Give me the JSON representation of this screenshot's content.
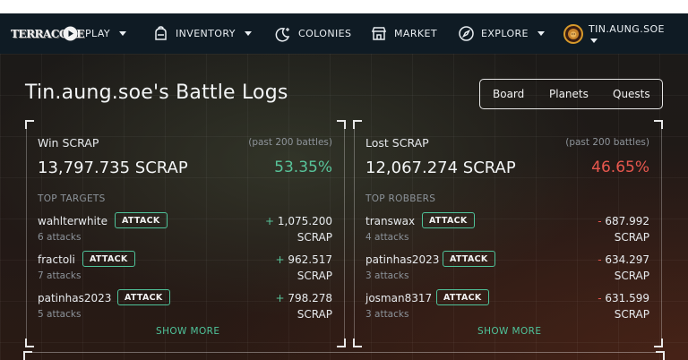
{
  "nav": {
    "logo": "TERRACORE",
    "items": [
      {
        "label": "PLAY",
        "icon": "play-circle-icon",
        "dropdown": true
      },
      {
        "label": "INVENTORY",
        "icon": "backpack-icon",
        "dropdown": true
      },
      {
        "label": "COLONIES",
        "icon": "moon-stars-icon",
        "dropdown": false
      },
      {
        "label": "MARKET",
        "icon": "storefront-icon",
        "dropdown": false
      },
      {
        "label": "EXPLORE",
        "icon": "compass-icon",
        "dropdown": true
      }
    ],
    "user": {
      "name": "TIN.AUNG.SOE",
      "icon": "lion-avatar-icon"
    }
  },
  "page": {
    "title": "Tin.aung.soe's Battle Logs",
    "tabs": [
      "Board",
      "Planets",
      "Quests"
    ]
  },
  "win_panel": {
    "title": "Win SCRAP",
    "note": "(past 200 battles)",
    "total": "13,797.735 SCRAP",
    "percent": "53.35%",
    "section": "TOP TARGETS",
    "rows": [
      {
        "name": "wahlterwhite",
        "sub": "6 attacks",
        "button": "ATTACK",
        "sign": "+",
        "amount": "1,075.200",
        "unit": "SCRAP"
      },
      {
        "name": "fractoli",
        "sub": "7 attacks",
        "button": "ATTACK",
        "sign": "+",
        "amount": "962.517",
        "unit": "SCRAP"
      },
      {
        "name": "patinhas2023",
        "sub": "5 attacks",
        "button": "ATTACK",
        "sign": "+",
        "amount": "798.278",
        "unit": "SCRAP"
      }
    ],
    "show_more": "SHOW MORE"
  },
  "lost_panel": {
    "title": "Lost SCRAP",
    "note": "(past 200 battles)",
    "total": "12,067.274 SCRAP",
    "percent": "46.65%",
    "section": "TOP ROBBERS",
    "rows": [
      {
        "name": "transwax",
        "sub": "4 attacks",
        "button": "ATTACK",
        "sign": "-",
        "amount": "687.992",
        "unit": "SCRAP"
      },
      {
        "name": "patinhas2023",
        "sub": "3 attacks",
        "button": "ATTACK",
        "sign": "-",
        "amount": "634.297",
        "unit": "SCRAP"
      },
      {
        "name": "josman8317",
        "sub": "3 attacks",
        "button": "ATTACK",
        "sign": "-",
        "amount": "631.599",
        "unit": "SCRAP"
      }
    ],
    "show_more": "SHOW MORE"
  },
  "colors": {
    "accent_green": "#58c49a",
    "loss_red": "#e8574e",
    "nav_bg": "#0f1b24"
  }
}
